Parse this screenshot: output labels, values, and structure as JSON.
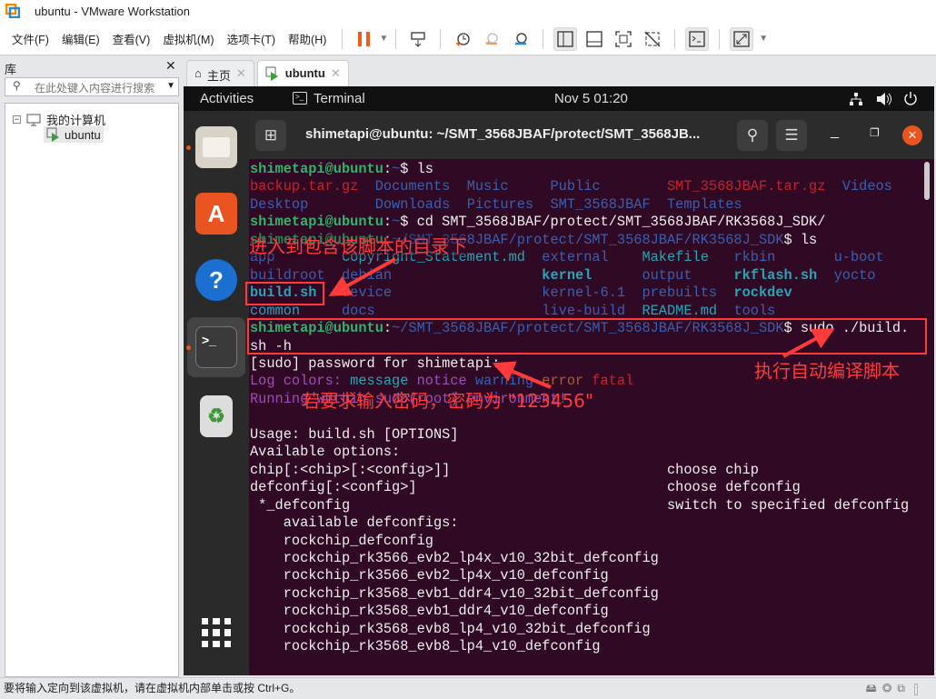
{
  "window": {
    "title": "ubuntu - VMware Workstation"
  },
  "menu": [
    "文件(F)",
    "编辑(E)",
    "查看(V)",
    "虚拟机(M)",
    "选项卡(T)",
    "帮助(H)"
  ],
  "library": {
    "title": "库",
    "search_placeholder": "在此处键入内容进行搜索",
    "tree_root": "我的计算机",
    "tree_vm": "ubuntu"
  },
  "tabs": [
    {
      "label": "主页"
    },
    {
      "label": "ubuntu"
    }
  ],
  "ubuntu": {
    "activities": "Activities",
    "app": "Terminal",
    "clock": "Nov 5  01:20"
  },
  "terminal": {
    "title": "shimetapi@ubuntu: ~/SMT_3568JBAF/protect/SMT_3568JB...",
    "user": "shimetapi@ubuntu",
    "cmd1": "ls",
    "ls1": [
      [
        {
          "t": "backup.tar.gz",
          "c": "r"
        },
        {
          "t": "Documents",
          "c": "b"
        },
        {
          "t": "Music",
          "c": "b"
        },
        {
          "t": "Public",
          "c": "b"
        },
        {
          "t": "SMT_3568JBAF.tar.gz",
          "c": "r"
        },
        {
          "t": "Videos",
          "c": "b"
        }
      ],
      [
        {
          "t": "Desktop",
          "c": "b"
        },
        {
          "t": "Downloads",
          "c": "b"
        },
        {
          "t": "Pictures",
          "c": "b"
        },
        {
          "t": "SMT_3568JBAF",
          "c": "b"
        },
        {
          "t": "Templates",
          "c": "b"
        }
      ]
    ],
    "cmd2": "cd SMT_3568JBAF/protect/SMT_3568JBAF/RK3568J_SDK/",
    "sdk_path": "~/SMT_3568JBAF/protect/SMT_3568JBAF/RK3568J_SDK",
    "cmd3": "ls",
    "ls2": [
      [
        {
          "t": "app",
          "c": "b"
        },
        {
          "t": "Copyright_Statement.md",
          "c": "cy"
        },
        {
          "t": "external",
          "c": "b"
        },
        {
          "t": "Makefile",
          "c": "cy"
        },
        {
          "t": "rkbin",
          "c": "b"
        },
        {
          "t": "u-boot",
          "c": "b"
        }
      ],
      [
        {
          "t": "buildroot",
          "c": "b"
        },
        {
          "t": "debian",
          "c": "b"
        },
        {
          "t": "",
          "c": "b"
        },
        {
          "t": "kernel",
          "c": "c"
        },
        {
          "t": "output",
          "c": "b"
        },
        {
          "t": "rkflash.sh",
          "c": "c"
        },
        {
          "t": "yocto",
          "c": "b"
        }
      ],
      [
        {
          "t": "build.sh",
          "c": "c"
        },
        {
          "t": "device",
          "c": "b"
        },
        {
          "t": "",
          "c": "b"
        },
        {
          "t": "kernel-6.1",
          "c": "b"
        },
        {
          "t": "prebuilts",
          "c": "b"
        },
        {
          "t": "rockdev",
          "c": "c"
        }
      ],
      [
        {
          "t": "common",
          "c": "cy"
        },
        {
          "t": "docs",
          "c": "b"
        },
        {
          "t": "",
          "c": "b"
        },
        {
          "t": "live-build",
          "c": "b"
        },
        {
          "t": "README.md",
          "c": "cy"
        },
        {
          "t": "tools",
          "c": "b"
        }
      ]
    ],
    "cmd4a": "sudo ./build.",
    "cmd4b": "sh -h",
    "sudo_prompt": "[sudo] password for shimetapi:",
    "log_colors": [
      {
        "t": "Log colors: ",
        "c": "p"
      },
      {
        "t": "message ",
        "c": "cy"
      },
      {
        "t": "notice ",
        "c": "p"
      },
      {
        "t": "warning ",
        "c": "b"
      },
      {
        "t": "error ",
        "c": "o"
      },
      {
        "t": "fatal",
        "c": "r"
      }
    ],
    "running": "Running within sudo(root) environment!",
    "output": [
      "",
      "Usage: build.sh [OPTIONS]",
      "Available options:",
      "chip[:<chip>[:<config>]]                          choose chip",
      "defconfig[:<config>]                              choose defconfig",
      " *_defconfig                                      switch to specified defconfig",
      "    available defconfigs:",
      "    rockchip_defconfig",
      "    rockchip_rk3566_evb2_lp4x_v10_32bit_defconfig",
      "    rockchip_rk3566_evb2_lp4x_v10_defconfig",
      "    rockchip_rk3568_evb1_ddr4_v10_32bit_defconfig",
      "    rockchip_rk3568_evb1_ddr4_v10_defconfig",
      "    rockchip_rk3568_evb8_lp4_v10_32bit_defconfig",
      "    rockchip_rk3568_evb8_lp4_v10_defconfig"
    ]
  },
  "annotations": {
    "enter_dir": "进入到包含该脚本的目录下",
    "run_script": "执行自动编译脚本",
    "password": "若要求输入密码，密码为 \"123456\""
  },
  "status": {
    "text": "要将输入定向到该虚拟机，请在虚拟机内部单击或按 Ctrl+G。"
  },
  "colors": {
    "terminal_bg": "#300a24",
    "annotation": "#ff3a3a",
    "accent": "#e95420"
  }
}
